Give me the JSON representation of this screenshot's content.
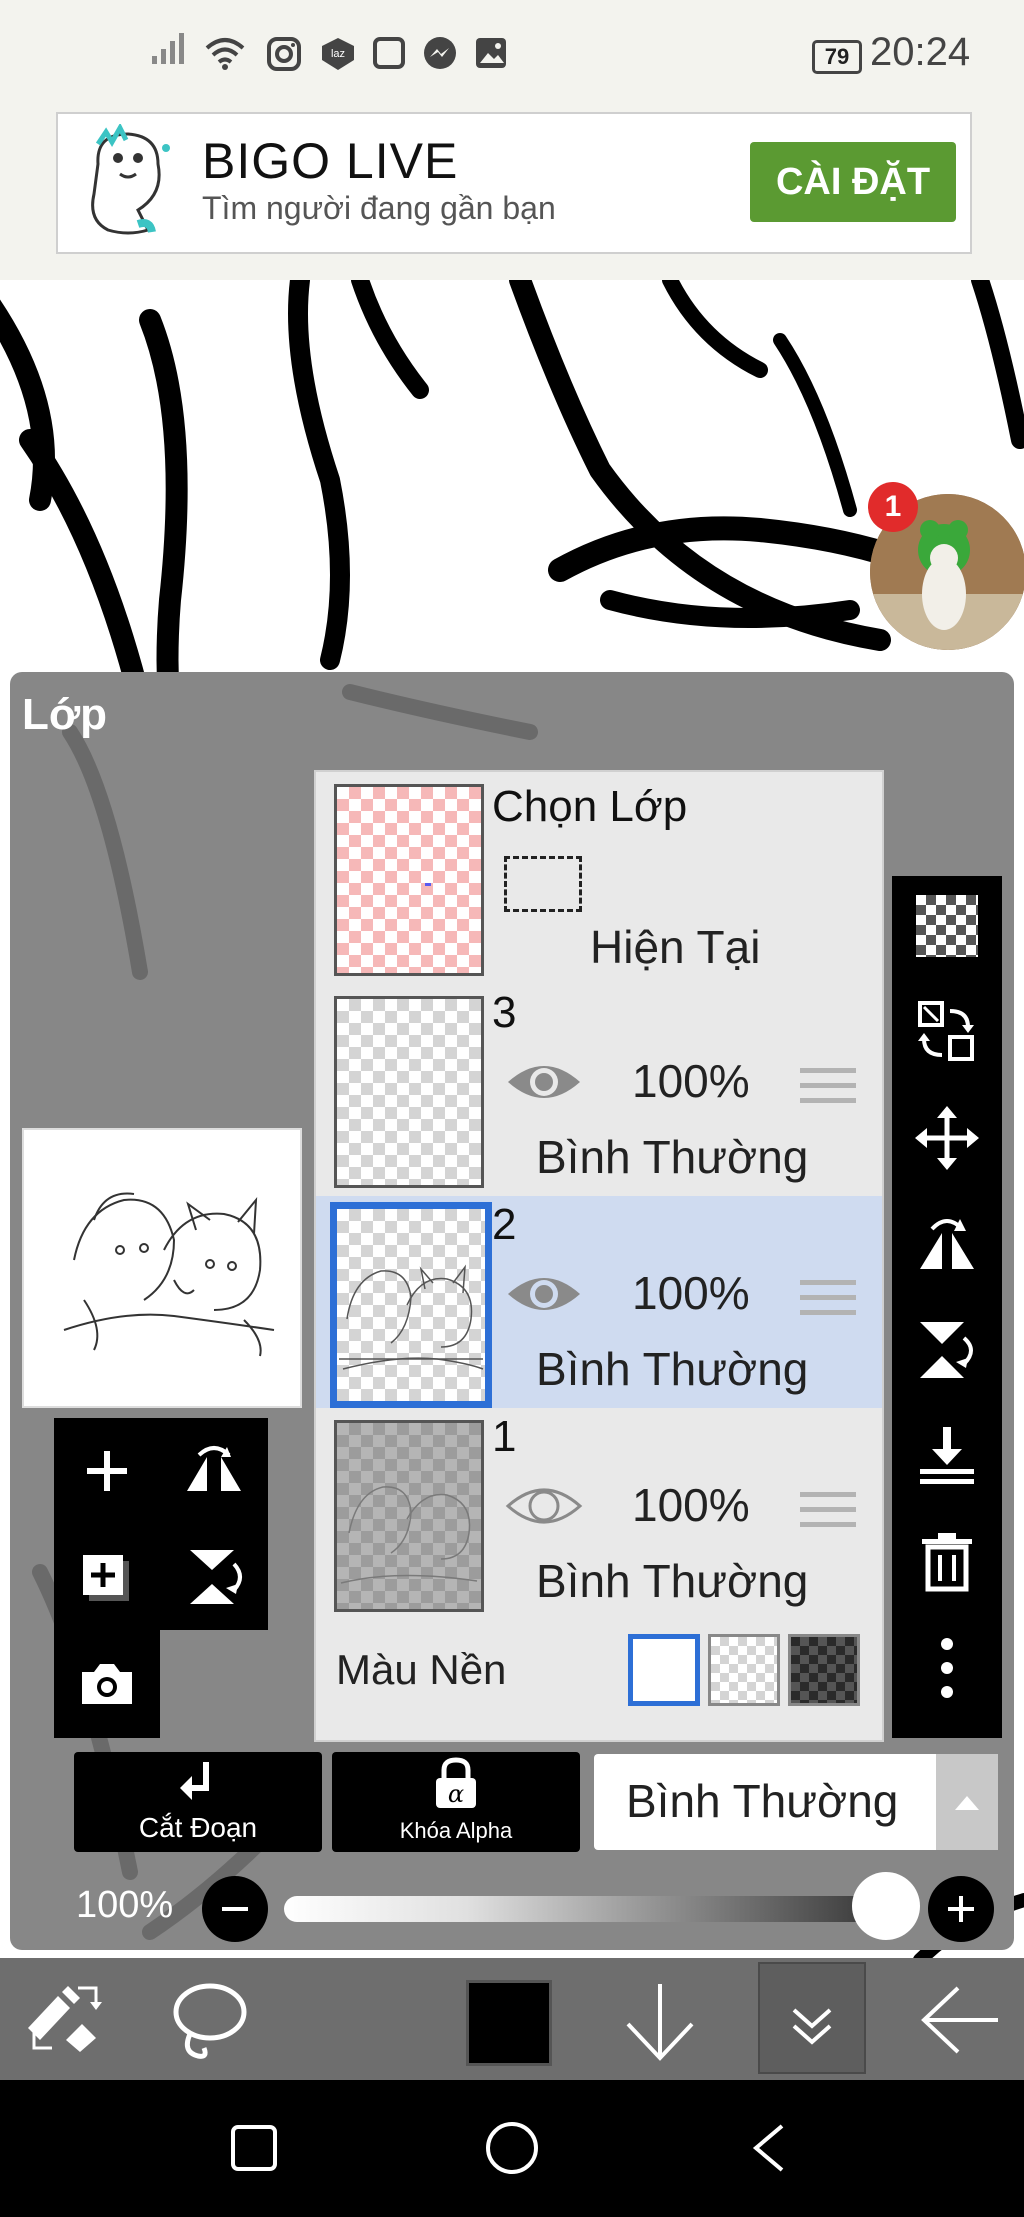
{
  "status_bar": {
    "icons": [
      "signal-icon",
      "wifi-icon",
      "instagram-icon",
      "lazada-icon",
      "square-icon",
      "messenger-icon",
      "gallery-icon"
    ],
    "battery": "79",
    "time": "20:24"
  },
  "ad": {
    "title": "BIGO LIVE",
    "subtitle": "Tìm người đang gần bạn",
    "button": "CÀI ĐẶT",
    "button_color": "#5b9a32"
  },
  "bubble": {
    "badge": "1"
  },
  "panel": {
    "title": "Lớp",
    "select_layer": {
      "title": "Chọn Lớp",
      "current": "Hiện Tại"
    },
    "layers": [
      {
        "name": "3",
        "opacity": "100%",
        "mode": "Bình Thường",
        "visible": true,
        "selected": false
      },
      {
        "name": "2",
        "opacity": "100%",
        "mode": "Bình Thường",
        "visible": true,
        "selected": true
      },
      {
        "name": "1",
        "opacity": "100%",
        "mode": "Bình Thường",
        "visible": false,
        "selected": false
      }
    ],
    "background": {
      "label": "Màu Nền",
      "options": [
        "white",
        "transparent",
        "dark"
      ],
      "selected": "white"
    },
    "actions": {
      "clip": "Cắt Đoạn",
      "alpha_lock": "Khóa Alpha"
    },
    "blend_mode": "Bình Thường",
    "opacity": "100%",
    "opacity_value": 1.0,
    "accent": "#2d6fd6"
  },
  "side_tools": [
    "checker-icon",
    "transfer-icon",
    "move-icon",
    "flip-h-icon",
    "flip-v-icon",
    "merge-down-icon",
    "trash-icon",
    "more-icon"
  ],
  "mini_tools": [
    "add-layer-icon",
    "flip-layer-icon",
    "add-folder-icon",
    "flip-vertical-icon",
    "camera-icon"
  ],
  "bottom_toolbar": [
    "swap-tool-icon",
    "lasso-icon",
    "color-swatch",
    "arrow-down-icon",
    "layers-collapse-icon",
    "back-arrow-icon"
  ],
  "nav": [
    "recent-apps-icon",
    "home-icon",
    "back-icon"
  ]
}
